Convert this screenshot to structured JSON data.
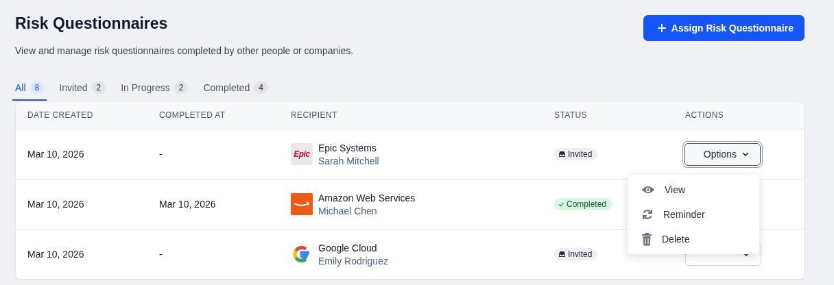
{
  "header": {
    "title": "Risk Questionnaires",
    "subtitle": "View and manage risk questionnaires completed by other people or companies.",
    "assign_button": "Assign Risk Questionnaire"
  },
  "tabs": [
    {
      "label": "All",
      "count": "8",
      "selected": true
    },
    {
      "label": "Invited",
      "count": "2",
      "selected": false
    },
    {
      "label": "In Progress",
      "count": "2",
      "selected": false
    },
    {
      "label": "Completed",
      "count": "4",
      "selected": false
    }
  ],
  "table": {
    "columns": [
      "DATE CREATED",
      "COMPLETED AT",
      "RECIPIENT",
      "STATUS",
      "ACTIONS"
    ],
    "rows": [
      {
        "date_created": "Mar 10, 2026",
        "completed_at": "-",
        "logo": {
          "kind": "epic",
          "text": "Epic"
        },
        "company": "Epic Systems",
        "person": "Sarah Mitchell",
        "status": {
          "kind": "invited",
          "label": "Invited"
        },
        "action": {
          "label": "Options",
          "open": true
        }
      },
      {
        "date_created": "Mar 10, 2026",
        "completed_at": "Mar 10, 2026",
        "logo": {
          "kind": "amazon"
        },
        "company": "Amazon Web Services",
        "person": "Michael Chen",
        "status": {
          "kind": "completed",
          "label": "Completed"
        }
      },
      {
        "date_created": "Mar 10, 2026",
        "completed_at": "-",
        "logo": {
          "kind": "google"
        },
        "company": "Google Cloud",
        "person": "Emily Rodriguez",
        "status": {
          "kind": "invited",
          "label": "Invited"
        },
        "action": {
          "open": false
        }
      }
    ]
  },
  "menu": {
    "items": [
      {
        "kind": "view",
        "label": "View"
      },
      {
        "kind": "reminder",
        "label": "Reminder"
      },
      {
        "kind": "delete",
        "label": "Delete"
      }
    ]
  }
}
